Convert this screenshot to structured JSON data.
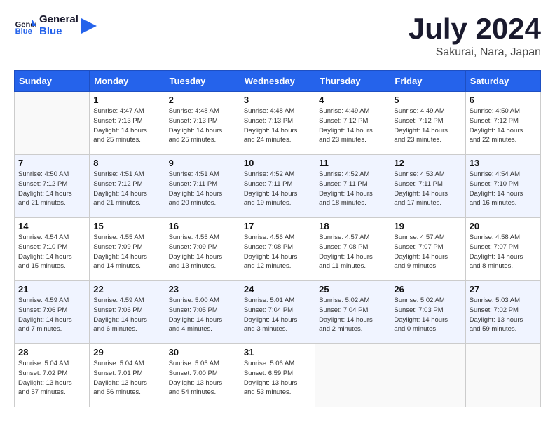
{
  "header": {
    "logo_general": "General",
    "logo_blue": "Blue",
    "month": "July 2024",
    "location": "Sakurai, Nara, Japan"
  },
  "days_of_week": [
    "Sunday",
    "Monday",
    "Tuesday",
    "Wednesday",
    "Thursday",
    "Friday",
    "Saturday"
  ],
  "weeks": [
    [
      {
        "day": "",
        "info": ""
      },
      {
        "day": "1",
        "info": "Sunrise: 4:47 AM\nSunset: 7:13 PM\nDaylight: 14 hours\nand 25 minutes."
      },
      {
        "day": "2",
        "info": "Sunrise: 4:48 AM\nSunset: 7:13 PM\nDaylight: 14 hours\nand 25 minutes."
      },
      {
        "day": "3",
        "info": "Sunrise: 4:48 AM\nSunset: 7:13 PM\nDaylight: 14 hours\nand 24 minutes."
      },
      {
        "day": "4",
        "info": "Sunrise: 4:49 AM\nSunset: 7:12 PM\nDaylight: 14 hours\nand 23 minutes."
      },
      {
        "day": "5",
        "info": "Sunrise: 4:49 AM\nSunset: 7:12 PM\nDaylight: 14 hours\nand 23 minutes."
      },
      {
        "day": "6",
        "info": "Sunrise: 4:50 AM\nSunset: 7:12 PM\nDaylight: 14 hours\nand 22 minutes."
      }
    ],
    [
      {
        "day": "7",
        "info": "Sunrise: 4:50 AM\nSunset: 7:12 PM\nDaylight: 14 hours\nand 21 minutes."
      },
      {
        "day": "8",
        "info": "Sunrise: 4:51 AM\nSunset: 7:12 PM\nDaylight: 14 hours\nand 21 minutes."
      },
      {
        "day": "9",
        "info": "Sunrise: 4:51 AM\nSunset: 7:11 PM\nDaylight: 14 hours\nand 20 minutes."
      },
      {
        "day": "10",
        "info": "Sunrise: 4:52 AM\nSunset: 7:11 PM\nDaylight: 14 hours\nand 19 minutes."
      },
      {
        "day": "11",
        "info": "Sunrise: 4:52 AM\nSunset: 7:11 PM\nDaylight: 14 hours\nand 18 minutes."
      },
      {
        "day": "12",
        "info": "Sunrise: 4:53 AM\nSunset: 7:11 PM\nDaylight: 14 hours\nand 17 minutes."
      },
      {
        "day": "13",
        "info": "Sunrise: 4:54 AM\nSunset: 7:10 PM\nDaylight: 14 hours\nand 16 minutes."
      }
    ],
    [
      {
        "day": "14",
        "info": "Sunrise: 4:54 AM\nSunset: 7:10 PM\nDaylight: 14 hours\nand 15 minutes."
      },
      {
        "day": "15",
        "info": "Sunrise: 4:55 AM\nSunset: 7:09 PM\nDaylight: 14 hours\nand 14 minutes."
      },
      {
        "day": "16",
        "info": "Sunrise: 4:55 AM\nSunset: 7:09 PM\nDaylight: 14 hours\nand 13 minutes."
      },
      {
        "day": "17",
        "info": "Sunrise: 4:56 AM\nSunset: 7:08 PM\nDaylight: 14 hours\nand 12 minutes."
      },
      {
        "day": "18",
        "info": "Sunrise: 4:57 AM\nSunset: 7:08 PM\nDaylight: 14 hours\nand 11 minutes."
      },
      {
        "day": "19",
        "info": "Sunrise: 4:57 AM\nSunset: 7:07 PM\nDaylight: 14 hours\nand 9 minutes."
      },
      {
        "day": "20",
        "info": "Sunrise: 4:58 AM\nSunset: 7:07 PM\nDaylight: 14 hours\nand 8 minutes."
      }
    ],
    [
      {
        "day": "21",
        "info": "Sunrise: 4:59 AM\nSunset: 7:06 PM\nDaylight: 14 hours\nand 7 minutes."
      },
      {
        "day": "22",
        "info": "Sunrise: 4:59 AM\nSunset: 7:06 PM\nDaylight: 14 hours\nand 6 minutes."
      },
      {
        "day": "23",
        "info": "Sunrise: 5:00 AM\nSunset: 7:05 PM\nDaylight: 14 hours\nand 4 minutes."
      },
      {
        "day": "24",
        "info": "Sunrise: 5:01 AM\nSunset: 7:04 PM\nDaylight: 14 hours\nand 3 minutes."
      },
      {
        "day": "25",
        "info": "Sunrise: 5:02 AM\nSunset: 7:04 PM\nDaylight: 14 hours\nand 2 minutes."
      },
      {
        "day": "26",
        "info": "Sunrise: 5:02 AM\nSunset: 7:03 PM\nDaylight: 14 hours\nand 0 minutes."
      },
      {
        "day": "27",
        "info": "Sunrise: 5:03 AM\nSunset: 7:02 PM\nDaylight: 13 hours\nand 59 minutes."
      }
    ],
    [
      {
        "day": "28",
        "info": "Sunrise: 5:04 AM\nSunset: 7:02 PM\nDaylight: 13 hours\nand 57 minutes."
      },
      {
        "day": "29",
        "info": "Sunrise: 5:04 AM\nSunset: 7:01 PM\nDaylight: 13 hours\nand 56 minutes."
      },
      {
        "day": "30",
        "info": "Sunrise: 5:05 AM\nSunset: 7:00 PM\nDaylight: 13 hours\nand 54 minutes."
      },
      {
        "day": "31",
        "info": "Sunrise: 5:06 AM\nSunset: 6:59 PM\nDaylight: 13 hours\nand 53 minutes."
      },
      {
        "day": "",
        "info": ""
      },
      {
        "day": "",
        "info": ""
      },
      {
        "day": "",
        "info": ""
      }
    ]
  ]
}
